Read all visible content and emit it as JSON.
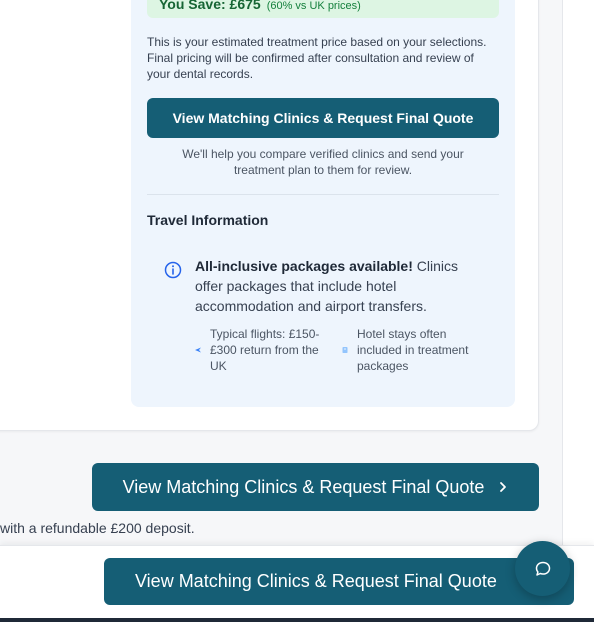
{
  "pricing": {
    "savings_label": "You Save: £675",
    "savings_note": "(60% vs UK prices)",
    "estimate_note": "This is your estimated treatment price based on your selections. Final pricing will be confirmed after consultation and review of your dental records.",
    "cta_label": "View Matching Clinics & Request Final Quote",
    "help_note": "We'll help you compare verified clinics and send your treatment plan to them for review."
  },
  "travel": {
    "title": "Travel Information",
    "info_bold": "All-inclusive packages available!",
    "info_rest": " Clinics offer packages that include hotel accommodation and airport transfers.",
    "features": [
      {
        "icon": "plane-icon",
        "text": "Typical flights: £150-£300 return from the UK"
      },
      {
        "icon": "hotel-icon",
        "text": "Hotel stays often included in treatment packages"
      }
    ]
  },
  "main_cta": {
    "label": "View Matching Clinics & Request Final Quote"
  },
  "deposit_note": "with a refundable £200 deposit.",
  "sticky_cta": {
    "label": "View Matching Clinics & Request Final Quote"
  },
  "chat": {
    "icon": "chat-bubble-icon"
  },
  "colors": {
    "primary": "#155e75",
    "panel": "#eef5fd",
    "savings_bg": "#ddf5e3",
    "info_accent": "#2563eb"
  }
}
